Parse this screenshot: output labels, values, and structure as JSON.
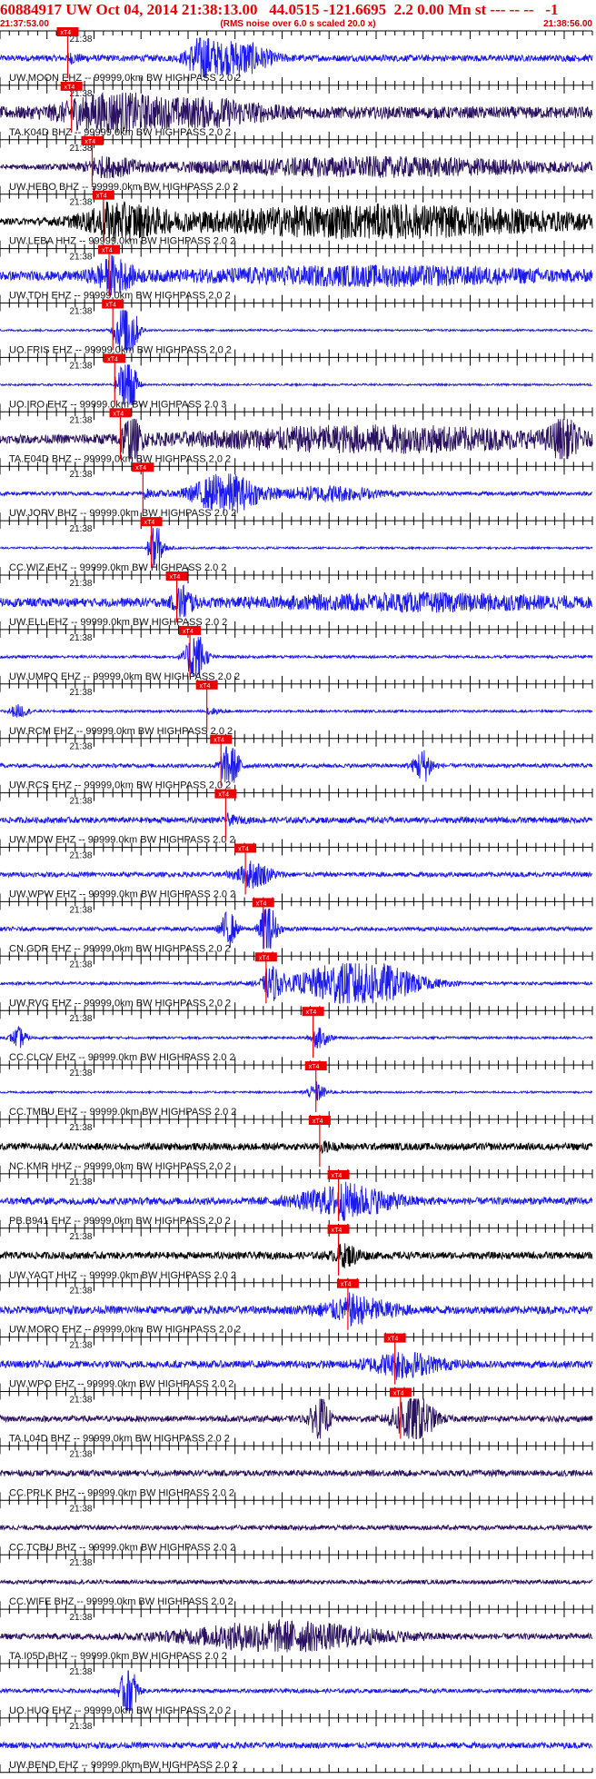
{
  "header": {
    "title": "60884917 UW Oct 04, 2014 21:38:13.00   44.0515 -121.6695  2.2 0.00 Mn st --- -- --   -1",
    "start_time": "21:37:53.00",
    "rms_note": "(RMS noise over 6.0 s scaled 20.0 x)",
    "end_time": "21:38:56.00"
  },
  "chart_data": {
    "type": "line",
    "title": "60884917 UW Oct 04, 2014 21:38:13.00   44.0515 -121.6695  2.2 0.00 Mn st --- -- --   -1",
    "xlim_seconds": [
      0,
      63
    ],
    "x_start": "21:37:53.00",
    "x_end": "21:38:56.00",
    "tick_label": "21:38",
    "tick_label_offset_seconds": 7,
    "pick_label": "xT4",
    "grid": false,
    "colors": {
      "blue": "#1a1aee",
      "dark": "#2a1060",
      "black": "#000000",
      "pick": "#ee0000"
    },
    "series": [
      {
        "name": "UW.MOON EHZ -- 99999.0km BW  HIGHPASS  2.0  2",
        "pick": 7.2,
        "color": "blue",
        "noise": 0.16,
        "bursts": [
          {
            "t": 21.5,
            "a": 1.0,
            "w": 1.5
          },
          {
            "t": 25.5,
            "a": 0.8,
            "w": 3
          }
        ]
      },
      {
        "name": "TA.K04D BHZ -- 99999.0km BW  HIGHPASS  2.0  2",
        "pick": 7.6,
        "color": "dark",
        "noise": 0.3,
        "bursts": [
          {
            "t": 12,
            "a": 0.8,
            "w": 5
          },
          {
            "t": 22,
            "a": 0.5,
            "w": 6
          }
        ]
      },
      {
        "name": "UW.HEBO BHZ -- 99999.0km BW  HIGHPASS  2.0  2",
        "pick": 9.8,
        "color": "dark",
        "noise": 0.1,
        "bursts": [
          {
            "t": 12,
            "a": 0.35,
            "w": 3
          },
          {
            "t": 40,
            "a": 0.45,
            "w": 22
          }
        ]
      },
      {
        "name": "UW.LEBA HHZ -- 99999.0km BW  HIGHPASS  2.0  2",
        "pick": 11.0,
        "color": "black",
        "noise": 0.1,
        "bursts": [
          {
            "t": 13,
            "a": 0.7,
            "w": 4
          },
          {
            "t": 40,
            "a": 0.8,
            "w": 24
          }
        ]
      },
      {
        "name": "UW.TDH EHZ -- 99999.0km BW  HIGHPASS  2.0  2",
        "pick": 11.6,
        "color": "blue",
        "noise": 0.22,
        "bursts": [
          {
            "t": 12,
            "a": 0.7,
            "w": 2
          },
          {
            "t": 40,
            "a": 0.35,
            "w": 20
          }
        ]
      },
      {
        "name": "UO.FRIS EHZ -- 99999.0km BW  HIGHPASS  2.0  2",
        "pick": 12.0,
        "color": "blue",
        "noise": 0.05,
        "bursts": [
          {
            "t": 13.5,
            "a": 2.0,
            "w": 1
          }
        ]
      },
      {
        "name": "UO.IRO EHZ -- 99999.0km BW  HIGHPASS  2.0  3",
        "pick": 12.2,
        "color": "blue",
        "noise": 0.05,
        "bursts": [
          {
            "t": 13.6,
            "a": 2.0,
            "w": 0.8
          }
        ]
      },
      {
        "name": "TA.E04D BHZ -- 99999.0km BW  HIGHPASS  2.0  2",
        "pick": 12.8,
        "color": "dark",
        "noise": 0.2,
        "bursts": [
          {
            "t": 14,
            "a": 0.9,
            "w": 1
          },
          {
            "t": 40,
            "a": 0.55,
            "w": 20
          },
          {
            "t": 60,
            "a": 0.8,
            "w": 1.5
          }
        ]
      },
      {
        "name": "UW.JORV BHZ -- 99999.0km BW  HIGHPASS  2.0  2",
        "pick": 15.2,
        "color": "blue",
        "noise": 0.1,
        "bursts": [
          {
            "t": 24,
            "a": 1.0,
            "w": 3.5
          },
          {
            "t": 35,
            "a": 0.35,
            "w": 5
          }
        ]
      },
      {
        "name": "CC.WIZ EHZ -- 99999.0km BW  HIGHPASS  2.0  2",
        "pick": 16.1,
        "color": "blue",
        "noise": 0.05,
        "bursts": [
          {
            "t": 16.5,
            "a": 1.2,
            "w": 0.7
          }
        ]
      },
      {
        "name": "UW.ELL EHZ -- 99999.0km BW  HIGHPASS  2.0  2",
        "pick": 18.8,
        "color": "blue",
        "noise": 0.22,
        "bursts": [
          {
            "t": 19.5,
            "a": 0.6,
            "w": 1
          },
          {
            "t": 45,
            "a": 0.3,
            "w": 16
          }
        ]
      },
      {
        "name": "UW.UMPQ EHZ -- 99999.0km BW  HIGHPASS  2.0  2",
        "pick": 20.2,
        "color": "blue",
        "noise": 0.07,
        "bursts": [
          {
            "t": 20.8,
            "a": 1.3,
            "w": 1
          }
        ]
      },
      {
        "name": "UW.RCM EHZ -- 99999.0km BW  HIGHPASS  2.0  2",
        "pick": 22.0,
        "color": "blue",
        "noise": 0.06,
        "bursts": [
          {
            "t": 2,
            "a": 0.3,
            "w": 1
          }
        ]
      },
      {
        "name": "UW.RCS EHZ -- 99999.0km BW  HIGHPASS  2.0  2",
        "pick": 23.5,
        "color": "blue",
        "noise": 0.1,
        "bursts": [
          {
            "t": 24.5,
            "a": 0.9,
            "w": 1
          },
          {
            "t": 45,
            "a": 0.8,
            "w": 1
          }
        ]
      },
      {
        "name": "UW.MDW EHZ -- 99999.0km BW  HIGHPASS  2.0  2",
        "pick": 24.0,
        "color": "blue",
        "noise": 0.15,
        "bursts": []
      },
      {
        "name": "UW.WPW EHZ -- 99999.0km BW  HIGHPASS  2.0  2",
        "pick": 26.1,
        "color": "blue",
        "noise": 0.12,
        "bursts": [
          {
            "t": 27,
            "a": 0.5,
            "w": 2
          }
        ]
      },
      {
        "name": "CN.GDR EHZ -- 99999.0km BW  HIGHPASS  2.0  2",
        "pick": 28.0,
        "color": "blue",
        "noise": 0.1,
        "bursts": [
          {
            "t": 24.3,
            "a": 0.9,
            "w": 0.8
          },
          {
            "t": 28.5,
            "a": 1.4,
            "w": 0.8
          }
        ]
      },
      {
        "name": "UW.RVC EHZ -- 99999.0km BW  HIGHPASS  2.0  2",
        "pick": 28.3,
        "color": "blue",
        "noise": 0.08,
        "bursts": [
          {
            "t": 29,
            "a": 0.6,
            "w": 1
          },
          {
            "t": 38,
            "a": 1.2,
            "w": 6
          }
        ]
      },
      {
        "name": "CC.CLCV EHZ -- 99999.0km BW  HIGHPASS  2.0  2",
        "pick": 33.3,
        "color": "blue",
        "noise": 0.06,
        "bursts": [
          {
            "t": 2,
            "a": 0.5,
            "w": 0.8
          },
          {
            "t": 34,
            "a": 0.35,
            "w": 1
          }
        ]
      },
      {
        "name": "CC.TMBU EHZ -- 99999.0km BW  HIGHPASS  2.0  2",
        "pick": 33.6,
        "color": "blue",
        "noise": 0.05,
        "bursts": [
          {
            "t": 33.5,
            "a": 0.3,
            "w": 1
          }
        ]
      },
      {
        "name": "NC.KMR HHZ -- 99999.0km BW  HIGHPASS  2.0  2",
        "pick": 34.0,
        "color": "black",
        "noise": 0.18,
        "bursts": []
      },
      {
        "name": "PB.B941 EHZ -- 99999.0km BW  HIGHPASS  2.0  2",
        "pick": 36.0,
        "color": "blue",
        "noise": 0.18,
        "bursts": [
          {
            "t": 37,
            "a": 0.7,
            "w": 5
          }
        ]
      },
      {
        "name": "UW.YACT HHZ -- 99999.0km BW  HIGHPASS  2.0  2",
        "pick": 36.0,
        "color": "black",
        "noise": 0.18,
        "bursts": [
          {
            "t": 37,
            "a": 0.35,
            "w": 1.5
          }
        ]
      },
      {
        "name": "UW.MORO EHZ -- 99999.0km BW  HIGHPASS  2.0  2",
        "pick": 37.0,
        "color": "blue",
        "noise": 0.2,
        "bursts": [
          {
            "t": 38,
            "a": 0.5,
            "w": 4
          }
        ]
      },
      {
        "name": "UW.WPO EHZ -- 99999.0km BW  HIGHPASS  2.0  2",
        "pick": 42.0,
        "color": "blue",
        "noise": 0.18,
        "bursts": [
          {
            "t": 43,
            "a": 0.5,
            "w": 4
          }
        ]
      },
      {
        "name": "TA.L04D BHZ -- 99999.0km BW  HIGHPASS  2.0  2",
        "pick": 42.6,
        "color": "dark",
        "noise": 0.15,
        "bursts": [
          {
            "t": 34,
            "a": 1.0,
            "w": 1
          },
          {
            "t": 44,
            "a": 1.3,
            "w": 2
          }
        ]
      },
      {
        "name": "CC.PRLK BHZ -- 99999.0km BW  HIGHPASS  2.0  2",
        "pick": null,
        "color": "dark",
        "noise": 0.15,
        "bursts": []
      },
      {
        "name": "CC.TCBU BHZ -- 99999.0km BW  HIGHPASS  2.0  2",
        "pick": null,
        "color": "dark",
        "noise": 0.12,
        "bursts": []
      },
      {
        "name": "CC.WIFE BHZ -- 99999.0km BW  HIGHPASS  2.0  2",
        "pick": null,
        "color": "dark",
        "noise": 0.1,
        "bursts": []
      },
      {
        "name": "TA.I05D BHZ -- 99999.0km BW  HIGHPASS  2.0  2",
        "pick": null,
        "color": "dark",
        "noise": 0.15,
        "bursts": [
          {
            "t": 30,
            "a": 0.7,
            "w": 10
          }
        ]
      },
      {
        "name": "UO.HUO EHZ -- 99999.0km BW  HIGHPASS  2.0  2",
        "pick": null,
        "color": "blue",
        "noise": 0.1,
        "bursts": [
          {
            "t": 13.7,
            "a": 1.5,
            "w": 0.8
          }
        ]
      },
      {
        "name": "UW.BEND EHZ -- 99999.0km BW  HIGHPASS  2.0  2",
        "pick": null,
        "color": "blue",
        "noise": 0.15,
        "bursts": []
      }
    ]
  }
}
